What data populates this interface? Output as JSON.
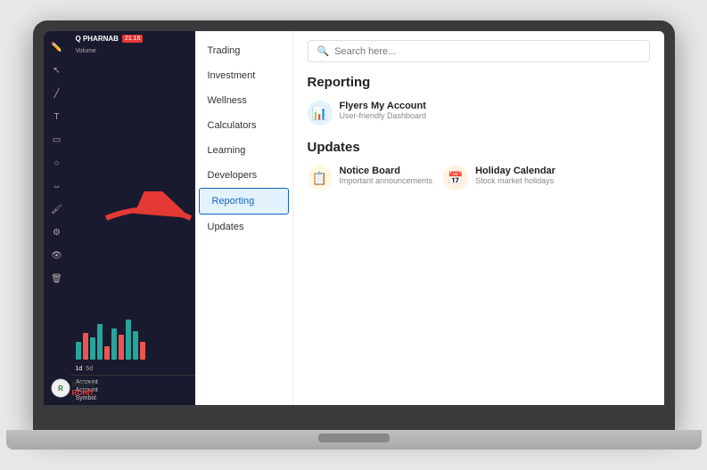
{
  "app": {
    "logo": "Q PHARNAB",
    "price": "21.16",
    "volume_label": "Volume",
    "time_options": [
      "1d",
      "5d"
    ],
    "active_time": "1d"
  },
  "nav": {
    "items": [
      {
        "label": "Trading",
        "active": false
      },
      {
        "label": "Investment",
        "active": false
      },
      {
        "label": "Wellness",
        "active": false
      },
      {
        "label": "Calculators",
        "active": false
      },
      {
        "label": "Learning",
        "active": false
      },
      {
        "label": "Developers",
        "active": false
      },
      {
        "label": "Reporting",
        "active": true
      },
      {
        "label": "Updates",
        "active": false
      }
    ]
  },
  "account": {
    "items": [
      "Account",
      "Account"
    ]
  },
  "search": {
    "placeholder": "Search here..."
  },
  "main": {
    "reporting_title": "Reporting",
    "reporting_items": [
      {
        "icon": "chart-icon",
        "title": "Flyers My Account",
        "subtitle": "User-friendly Dashboard"
      }
    ],
    "updates_title": "Updates",
    "updates_items": [
      {
        "icon": "notice-icon",
        "title": "Notice Board",
        "subtitle": "Important announcements"
      },
      {
        "icon": "calendar-icon",
        "title": "Holiday Calendar",
        "subtitle": "Stock market holidays"
      }
    ]
  },
  "watermark": {
    "line1": "Retire",
    "line2": "ROHIT"
  },
  "candles": [
    {
      "height": 20,
      "red": false
    },
    {
      "height": 30,
      "red": true
    },
    {
      "height": 25,
      "red": false
    },
    {
      "height": 40,
      "red": false
    },
    {
      "height": 15,
      "red": true
    },
    {
      "height": 35,
      "red": false
    },
    {
      "height": 28,
      "red": true
    },
    {
      "height": 45,
      "red": false
    },
    {
      "height": 32,
      "red": false
    },
    {
      "height": 20,
      "red": true
    }
  ]
}
